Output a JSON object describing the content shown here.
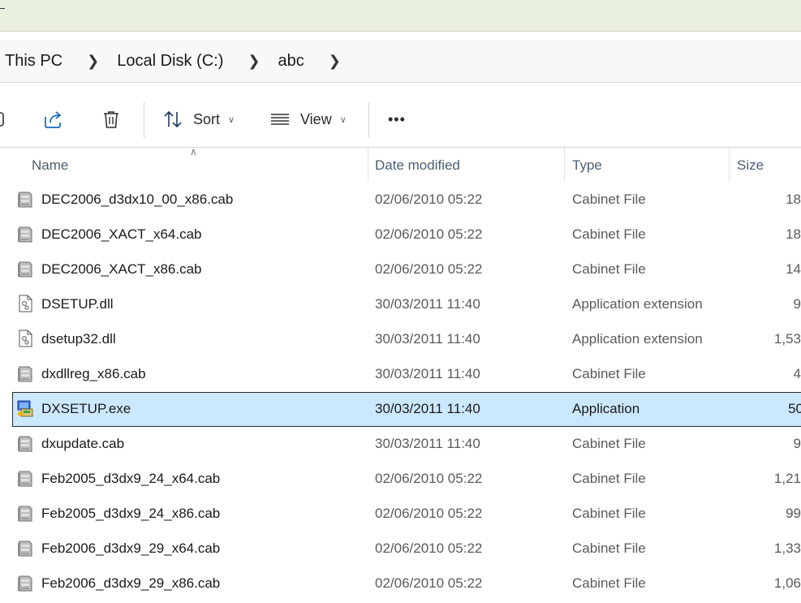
{
  "breadcrumb": [
    "This PC",
    "Local Disk (C:)",
    "abc"
  ],
  "toolbar": {
    "sort_label": "Sort",
    "view_label": "View",
    "more_label": "•••"
  },
  "columns": {
    "name": "Name",
    "date": "Date modified",
    "type": "Type",
    "size": "Size"
  },
  "files": [
    {
      "name": "DEC2006_d3dx10_00_x86.cab",
      "date": "02/06/2010 05:22",
      "type": "Cabinet File",
      "size": "18",
      "icon": "cabinet-file-icon"
    },
    {
      "name": "DEC2006_XACT_x64.cab",
      "date": "02/06/2010 05:22",
      "type": "Cabinet File",
      "size": "18",
      "icon": "cabinet-file-icon"
    },
    {
      "name": "DEC2006_XACT_x86.cab",
      "date": "02/06/2010 05:22",
      "type": "Cabinet File",
      "size": "14",
      "icon": "cabinet-file-icon"
    },
    {
      "name": "DSETUP.dll",
      "date": "30/03/2011 11:40",
      "type": "Application extension",
      "size": "9",
      "icon": "dll-file-icon"
    },
    {
      "name": "dsetup32.dll",
      "date": "30/03/2011 11:40",
      "type": "Application extension",
      "size": "1,53",
      "icon": "dll-file-icon"
    },
    {
      "name": "dxdllreg_x86.cab",
      "date": "30/03/2011 11:40",
      "type": "Cabinet File",
      "size": "4",
      "icon": "cabinet-file-icon"
    },
    {
      "name": "DXSETUP.exe",
      "date": "30/03/2011 11:40",
      "type": "Application",
      "size": "50",
      "icon": "setup-exe-icon",
      "selected": true
    },
    {
      "name": "dxupdate.cab",
      "date": "30/03/2011 11:40",
      "type": "Cabinet File",
      "size": "9",
      "icon": "cabinet-file-icon"
    },
    {
      "name": "Feb2005_d3dx9_24_x64.cab",
      "date": "02/06/2010 05:22",
      "type": "Cabinet File",
      "size": "1,21",
      "icon": "cabinet-file-icon"
    },
    {
      "name": "Feb2005_d3dx9_24_x86.cab",
      "date": "02/06/2010 05:22",
      "type": "Cabinet File",
      "size": "99",
      "icon": "cabinet-file-icon"
    },
    {
      "name": "Feb2006_d3dx9_29_x64.cab",
      "date": "02/06/2010 05:22",
      "type": "Cabinet File",
      "size": "1,33",
      "icon": "cabinet-file-icon"
    },
    {
      "name": "Feb2006_d3dx9_29_x86.cab",
      "date": "02/06/2010 05:22",
      "type": "Cabinet File",
      "size": "1,06",
      "icon": "cabinet-file-icon"
    }
  ],
  "colors": {
    "selected_bg": "#cce8ff",
    "header_text": "#4b5f73",
    "titlebar_bg": "#eaf0de"
  }
}
